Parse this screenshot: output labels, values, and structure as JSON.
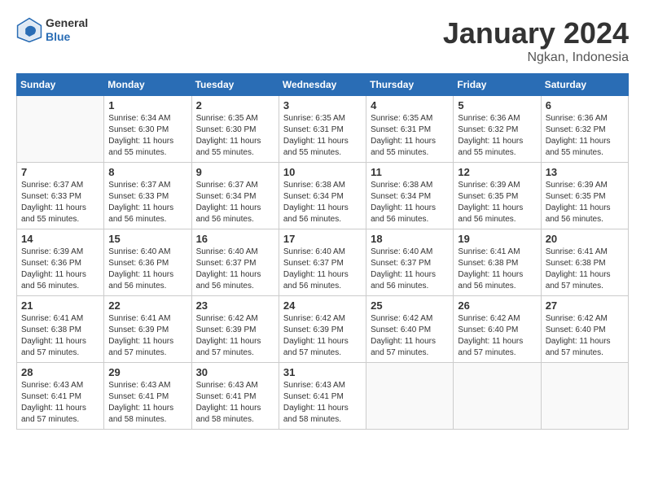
{
  "header": {
    "logo_line1": "General",
    "logo_line2": "Blue",
    "title": "January 2024",
    "subtitle": "Ngkan, Indonesia"
  },
  "weekdays": [
    "Sunday",
    "Monday",
    "Tuesday",
    "Wednesday",
    "Thursday",
    "Friday",
    "Saturday"
  ],
  "weeks": [
    [
      {
        "day": "",
        "info": ""
      },
      {
        "day": "1",
        "info": "Sunrise: 6:34 AM\nSunset: 6:30 PM\nDaylight: 11 hours\nand 55 minutes."
      },
      {
        "day": "2",
        "info": "Sunrise: 6:35 AM\nSunset: 6:30 PM\nDaylight: 11 hours\nand 55 minutes."
      },
      {
        "day": "3",
        "info": "Sunrise: 6:35 AM\nSunset: 6:31 PM\nDaylight: 11 hours\nand 55 minutes."
      },
      {
        "day": "4",
        "info": "Sunrise: 6:35 AM\nSunset: 6:31 PM\nDaylight: 11 hours\nand 55 minutes."
      },
      {
        "day": "5",
        "info": "Sunrise: 6:36 AM\nSunset: 6:32 PM\nDaylight: 11 hours\nand 55 minutes."
      },
      {
        "day": "6",
        "info": "Sunrise: 6:36 AM\nSunset: 6:32 PM\nDaylight: 11 hours\nand 55 minutes."
      }
    ],
    [
      {
        "day": "7",
        "info": "Sunrise: 6:37 AM\nSunset: 6:33 PM\nDaylight: 11 hours\nand 55 minutes."
      },
      {
        "day": "8",
        "info": "Sunrise: 6:37 AM\nSunset: 6:33 PM\nDaylight: 11 hours\nand 56 minutes."
      },
      {
        "day": "9",
        "info": "Sunrise: 6:37 AM\nSunset: 6:34 PM\nDaylight: 11 hours\nand 56 minutes."
      },
      {
        "day": "10",
        "info": "Sunrise: 6:38 AM\nSunset: 6:34 PM\nDaylight: 11 hours\nand 56 minutes."
      },
      {
        "day": "11",
        "info": "Sunrise: 6:38 AM\nSunset: 6:34 PM\nDaylight: 11 hours\nand 56 minutes."
      },
      {
        "day": "12",
        "info": "Sunrise: 6:39 AM\nSunset: 6:35 PM\nDaylight: 11 hours\nand 56 minutes."
      },
      {
        "day": "13",
        "info": "Sunrise: 6:39 AM\nSunset: 6:35 PM\nDaylight: 11 hours\nand 56 minutes."
      }
    ],
    [
      {
        "day": "14",
        "info": "Sunrise: 6:39 AM\nSunset: 6:36 PM\nDaylight: 11 hours\nand 56 minutes."
      },
      {
        "day": "15",
        "info": "Sunrise: 6:40 AM\nSunset: 6:36 PM\nDaylight: 11 hours\nand 56 minutes."
      },
      {
        "day": "16",
        "info": "Sunrise: 6:40 AM\nSunset: 6:37 PM\nDaylight: 11 hours\nand 56 minutes."
      },
      {
        "day": "17",
        "info": "Sunrise: 6:40 AM\nSunset: 6:37 PM\nDaylight: 11 hours\nand 56 minutes."
      },
      {
        "day": "18",
        "info": "Sunrise: 6:40 AM\nSunset: 6:37 PM\nDaylight: 11 hours\nand 56 minutes."
      },
      {
        "day": "19",
        "info": "Sunrise: 6:41 AM\nSunset: 6:38 PM\nDaylight: 11 hours\nand 56 minutes."
      },
      {
        "day": "20",
        "info": "Sunrise: 6:41 AM\nSunset: 6:38 PM\nDaylight: 11 hours\nand 57 minutes."
      }
    ],
    [
      {
        "day": "21",
        "info": "Sunrise: 6:41 AM\nSunset: 6:38 PM\nDaylight: 11 hours\nand 57 minutes."
      },
      {
        "day": "22",
        "info": "Sunrise: 6:41 AM\nSunset: 6:39 PM\nDaylight: 11 hours\nand 57 minutes."
      },
      {
        "day": "23",
        "info": "Sunrise: 6:42 AM\nSunset: 6:39 PM\nDaylight: 11 hours\nand 57 minutes."
      },
      {
        "day": "24",
        "info": "Sunrise: 6:42 AM\nSunset: 6:39 PM\nDaylight: 11 hours\nand 57 minutes."
      },
      {
        "day": "25",
        "info": "Sunrise: 6:42 AM\nSunset: 6:40 PM\nDaylight: 11 hours\nand 57 minutes."
      },
      {
        "day": "26",
        "info": "Sunrise: 6:42 AM\nSunset: 6:40 PM\nDaylight: 11 hours\nand 57 minutes."
      },
      {
        "day": "27",
        "info": "Sunrise: 6:42 AM\nSunset: 6:40 PM\nDaylight: 11 hours\nand 57 minutes."
      }
    ],
    [
      {
        "day": "28",
        "info": "Sunrise: 6:43 AM\nSunset: 6:41 PM\nDaylight: 11 hours\nand 57 minutes."
      },
      {
        "day": "29",
        "info": "Sunrise: 6:43 AM\nSunset: 6:41 PM\nDaylight: 11 hours\nand 58 minutes."
      },
      {
        "day": "30",
        "info": "Sunrise: 6:43 AM\nSunset: 6:41 PM\nDaylight: 11 hours\nand 58 minutes."
      },
      {
        "day": "31",
        "info": "Sunrise: 6:43 AM\nSunset: 6:41 PM\nDaylight: 11 hours\nand 58 minutes."
      },
      {
        "day": "",
        "info": ""
      },
      {
        "day": "",
        "info": ""
      },
      {
        "day": "",
        "info": ""
      }
    ]
  ]
}
